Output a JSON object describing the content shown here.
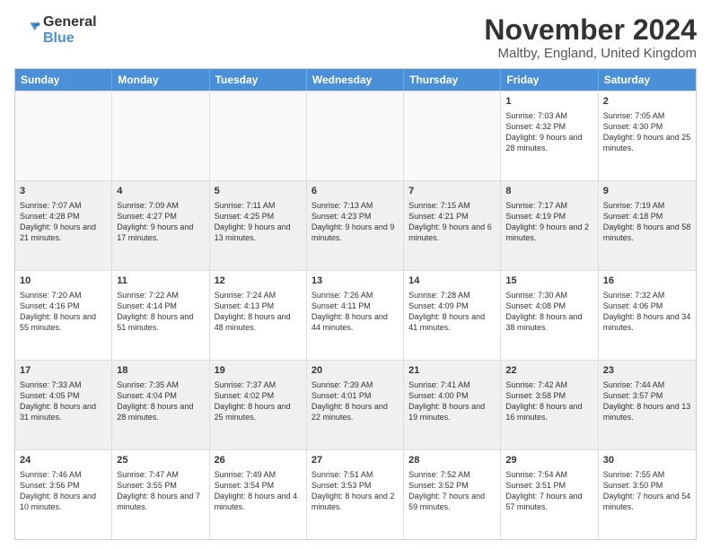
{
  "logo": {
    "general": "General",
    "blue": "Blue"
  },
  "title": "November 2024",
  "location": "Maltby, England, United Kingdom",
  "header_days": [
    "Sunday",
    "Monday",
    "Tuesday",
    "Wednesday",
    "Thursday",
    "Friday",
    "Saturday"
  ],
  "rows": [
    [
      {
        "day": "",
        "text": ""
      },
      {
        "day": "",
        "text": ""
      },
      {
        "day": "",
        "text": ""
      },
      {
        "day": "",
        "text": ""
      },
      {
        "day": "",
        "text": ""
      },
      {
        "day": "1",
        "text": "Sunrise: 7:03 AM\nSunset: 4:32 PM\nDaylight: 9 hours and 28 minutes."
      },
      {
        "day": "2",
        "text": "Sunrise: 7:05 AM\nSunset: 4:30 PM\nDaylight: 9 hours and 25 minutes."
      }
    ],
    [
      {
        "day": "3",
        "text": "Sunrise: 7:07 AM\nSunset: 4:28 PM\nDaylight: 9 hours and 21 minutes."
      },
      {
        "day": "4",
        "text": "Sunrise: 7:09 AM\nSunset: 4:27 PM\nDaylight: 9 hours and 17 minutes."
      },
      {
        "day": "5",
        "text": "Sunrise: 7:11 AM\nSunset: 4:25 PM\nDaylight: 9 hours and 13 minutes."
      },
      {
        "day": "6",
        "text": "Sunrise: 7:13 AM\nSunset: 4:23 PM\nDaylight: 9 hours and 9 minutes."
      },
      {
        "day": "7",
        "text": "Sunrise: 7:15 AM\nSunset: 4:21 PM\nDaylight: 9 hours and 6 minutes."
      },
      {
        "day": "8",
        "text": "Sunrise: 7:17 AM\nSunset: 4:19 PM\nDaylight: 9 hours and 2 minutes."
      },
      {
        "day": "9",
        "text": "Sunrise: 7:19 AM\nSunset: 4:18 PM\nDaylight: 8 hours and 58 minutes."
      }
    ],
    [
      {
        "day": "10",
        "text": "Sunrise: 7:20 AM\nSunset: 4:16 PM\nDaylight: 8 hours and 55 minutes."
      },
      {
        "day": "11",
        "text": "Sunrise: 7:22 AM\nSunset: 4:14 PM\nDaylight: 8 hours and 51 minutes."
      },
      {
        "day": "12",
        "text": "Sunrise: 7:24 AM\nSunset: 4:13 PM\nDaylight: 8 hours and 48 minutes."
      },
      {
        "day": "13",
        "text": "Sunrise: 7:26 AM\nSunset: 4:11 PM\nDaylight: 8 hours and 44 minutes."
      },
      {
        "day": "14",
        "text": "Sunrise: 7:28 AM\nSunset: 4:09 PM\nDaylight: 8 hours and 41 minutes."
      },
      {
        "day": "15",
        "text": "Sunrise: 7:30 AM\nSunset: 4:08 PM\nDaylight: 8 hours and 38 minutes."
      },
      {
        "day": "16",
        "text": "Sunrise: 7:32 AM\nSunset: 4:06 PM\nDaylight: 8 hours and 34 minutes."
      }
    ],
    [
      {
        "day": "17",
        "text": "Sunrise: 7:33 AM\nSunset: 4:05 PM\nDaylight: 8 hours and 31 minutes."
      },
      {
        "day": "18",
        "text": "Sunrise: 7:35 AM\nSunset: 4:04 PM\nDaylight: 8 hours and 28 minutes."
      },
      {
        "day": "19",
        "text": "Sunrise: 7:37 AM\nSunset: 4:02 PM\nDaylight: 8 hours and 25 minutes."
      },
      {
        "day": "20",
        "text": "Sunrise: 7:39 AM\nSunset: 4:01 PM\nDaylight: 8 hours and 22 minutes."
      },
      {
        "day": "21",
        "text": "Sunrise: 7:41 AM\nSunset: 4:00 PM\nDaylight: 8 hours and 19 minutes."
      },
      {
        "day": "22",
        "text": "Sunrise: 7:42 AM\nSunset: 3:58 PM\nDaylight: 8 hours and 16 minutes."
      },
      {
        "day": "23",
        "text": "Sunrise: 7:44 AM\nSunset: 3:57 PM\nDaylight: 8 hours and 13 minutes."
      }
    ],
    [
      {
        "day": "24",
        "text": "Sunrise: 7:46 AM\nSunset: 3:56 PM\nDaylight: 8 hours and 10 minutes."
      },
      {
        "day": "25",
        "text": "Sunrise: 7:47 AM\nSunset: 3:55 PM\nDaylight: 8 hours and 7 minutes."
      },
      {
        "day": "26",
        "text": "Sunrise: 7:49 AM\nSunset: 3:54 PM\nDaylight: 8 hours and 4 minutes."
      },
      {
        "day": "27",
        "text": "Sunrise: 7:51 AM\nSunset: 3:53 PM\nDaylight: 8 hours and 2 minutes."
      },
      {
        "day": "28",
        "text": "Sunrise: 7:52 AM\nSunset: 3:52 PM\nDaylight: 7 hours and 59 minutes."
      },
      {
        "day": "29",
        "text": "Sunrise: 7:54 AM\nSunset: 3:51 PM\nDaylight: 7 hours and 57 minutes."
      },
      {
        "day": "30",
        "text": "Sunrise: 7:55 AM\nSunset: 3:50 PM\nDaylight: 7 hours and 54 minutes."
      }
    ]
  ]
}
